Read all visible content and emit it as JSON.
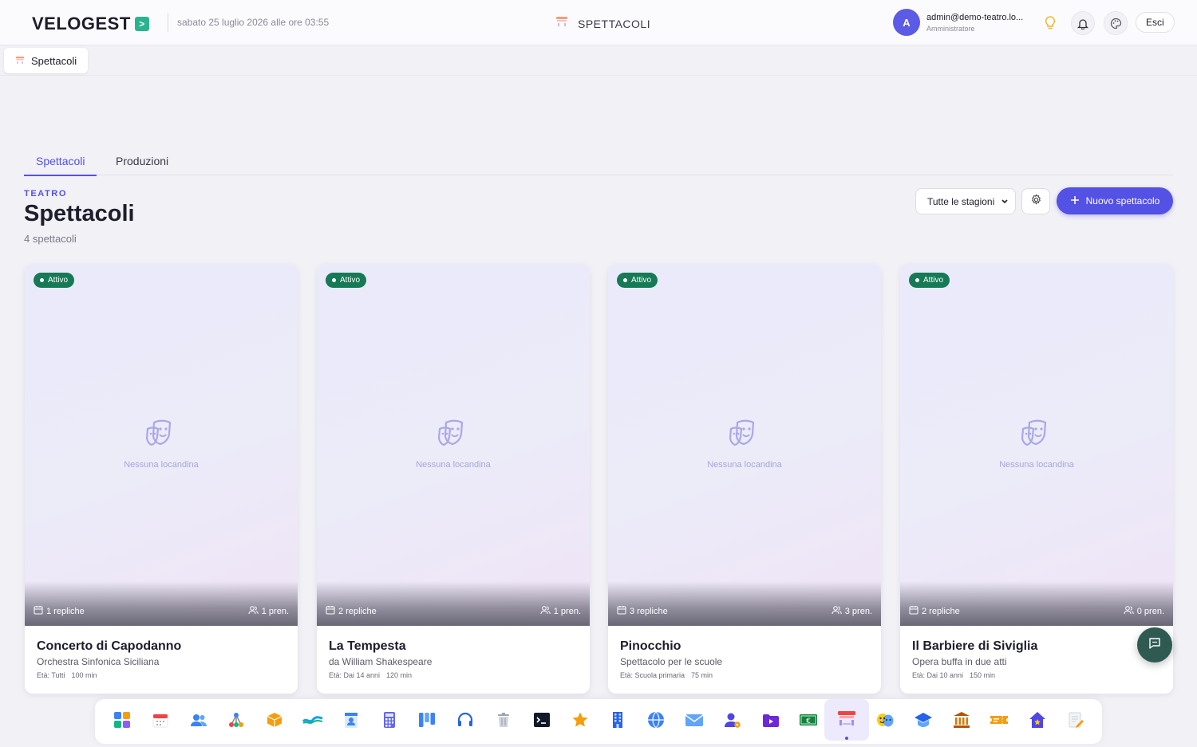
{
  "topbar": {
    "brand": "VELOGEST",
    "brand_badge": ">",
    "datetime": "sabato 25 luglio 2026 alle ore 03:55",
    "page_heading": "SPETTACOLI",
    "user_initial": "A",
    "user_email": "admin@demo-teatro.lo...",
    "user_role": "Amministratore",
    "logout_label": "Esci"
  },
  "open_tab": {
    "label": "Spettacoli",
    "icon": "theater-stage-icon"
  },
  "section_tabs": [
    {
      "label": "Spettacoli",
      "active": true
    },
    {
      "label": "Produzioni",
      "active": false
    }
  ],
  "header": {
    "kicker": "TEATRO",
    "title": "Spettacoli",
    "subtitle": "4 spettacoli",
    "season_select": "Tutte le stagioni",
    "new_button": "Nuovo spettacolo"
  },
  "cards": [
    {
      "status": "Attivo",
      "no_poster": "Nessuna locandina",
      "repliche": "1 repliche",
      "prenotazioni": "1 pren.",
      "title": "Concerto di Capodanno",
      "subtitle": "Orchestra Sinfonica Siciliana",
      "eta": "Età: Tutti",
      "durata": "100 min"
    },
    {
      "status": "Attivo",
      "no_poster": "Nessuna locandina",
      "repliche": "2 repliche",
      "prenotazioni": "1 pren.",
      "title": "La Tempesta",
      "subtitle": "da William Shakespeare",
      "eta": "Età: Dai 14 anni",
      "durata": "120 min"
    },
    {
      "status": "Attivo",
      "no_poster": "Nessuna locandina",
      "repliche": "3 repliche",
      "prenotazioni": "3 pren.",
      "title": "Pinocchio",
      "subtitle": "Spettacolo per le scuole",
      "eta": "Età: Scuola primaria",
      "durata": "75 min"
    },
    {
      "status": "Attivo",
      "no_poster": "Nessuna locandina",
      "repliche": "2 repliche",
      "prenotazioni": "0 pren.",
      "title": "Il Barbiere di Siviglia",
      "subtitle": "Opera buffa in due atti",
      "eta": "Età: Dai 10 anni",
      "durata": "150 min"
    }
  ],
  "dock": [
    "dashboard-grid-icon",
    "calendar-icon",
    "users-icon",
    "network-icon",
    "package-icon",
    "wave-icon",
    "contact-card-icon",
    "calculator-icon",
    "kanban-icon",
    "headset-icon",
    "trash-icon",
    "terminal-icon",
    "star-icon",
    "building-icon",
    "globe-icon",
    "mail-icon",
    "user-settings-icon",
    "video-folder-icon",
    "money-icon",
    "theater-stage-icon",
    "theater-masks-icon",
    "school-icon",
    "bank-icon",
    "ticket-icon",
    "home-icon",
    "edit-note-icon"
  ],
  "colors": {
    "accent": "#5451e5",
    "active_badge": "#157a55",
    "brand_badge": "#2bb38f"
  }
}
